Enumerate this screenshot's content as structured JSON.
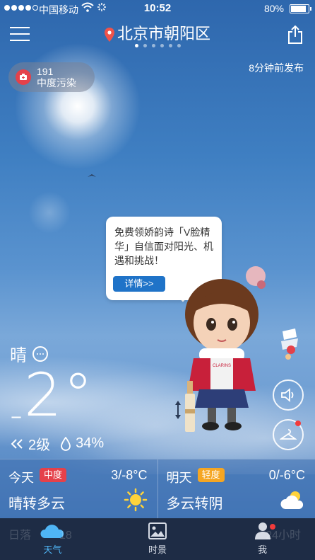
{
  "status_bar": {
    "carrier": "中国移动",
    "time": "10:52",
    "battery": "80%"
  },
  "header": {
    "location": "北京市朝阳区",
    "published": "8分钟前发布",
    "page_count": 6,
    "active_page": 0
  },
  "aqi": {
    "value": "191",
    "label": "中度污染",
    "color": "#e5414a"
  },
  "ad": {
    "text": "免费领娇韵诗「V脸精华」自信面对阳光、机遇和挑战！",
    "button": "详情>>"
  },
  "current": {
    "condition": "晴",
    "temperature": "2°",
    "wind": "2级",
    "humidity": "34%"
  },
  "forecast": {
    "today": {
      "day": "今天",
      "aqi_tag": "中度",
      "aqi_color": "#e5414a",
      "temp": "3/-8°C",
      "desc": "晴转多云",
      "icon": "sun-icon"
    },
    "tomorrow": {
      "day": "明天",
      "aqi_tag": "轻度",
      "aqi_color": "#f5a623",
      "temp": "0/-6°C",
      "desc": "多云转阴",
      "icon": "cloud-sun-icon"
    }
  },
  "tabbar": {
    "tabs": [
      {
        "label": "天气",
        "icon": "cloud-icon",
        "active": true
      },
      {
        "label": "时景",
        "icon": "photo-icon",
        "active": false
      },
      {
        "label": "我",
        "icon": "person-icon",
        "active": false
      }
    ],
    "behind_left": "日落",
    "behind_left_num": "18",
    "behind_right": "24小时"
  },
  "colors": {
    "accent": "#4fb5f5",
    "tabbar_bg": "#1e2c45",
    "button_blue": "#1f73c8"
  }
}
